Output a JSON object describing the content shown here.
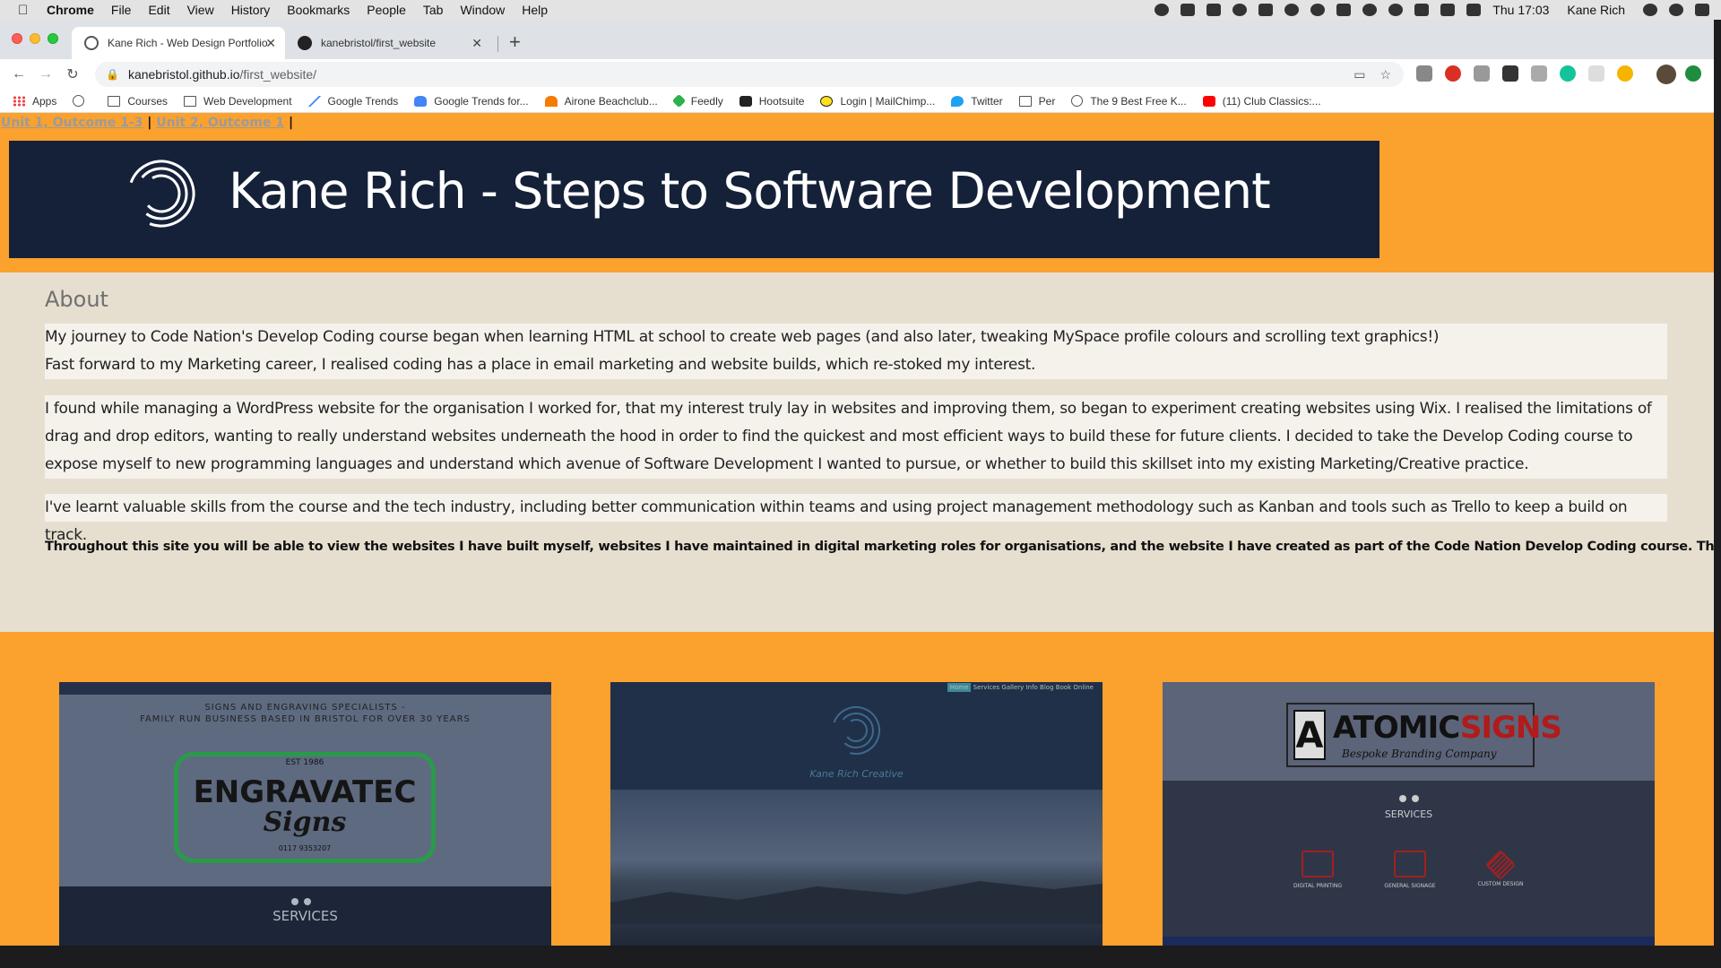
{
  "menubar": {
    "app_name": "Chrome",
    "items": [
      "File",
      "Edit",
      "View",
      "History",
      "Bookmarks",
      "People",
      "Tab",
      "Window",
      "Help"
    ],
    "clock": "Thu 17:03",
    "user": "Kane Rich"
  },
  "browser": {
    "tabs": [
      {
        "title": "Kane Rich - Web Design Portfolio",
        "active": true
      },
      {
        "title": "kanebristol/first_website",
        "active": false
      }
    ],
    "url_host": "kanebristol.github.io",
    "url_path": "/first_website/",
    "bookmarks": [
      {
        "label": "Apps",
        "icon": "apps-grid-icon"
      },
      {
        "label": "Courses",
        "icon": "folder-icon"
      },
      {
        "label": "Web Development",
        "icon": "folder-icon"
      },
      {
        "label": "Google Trends",
        "icon": "google-trends-icon"
      },
      {
        "label": "Google Trends for...",
        "icon": "google-trends-icon"
      },
      {
        "label": "Airone Beachclub...",
        "icon": "airone-icon"
      },
      {
        "label": "Feedly",
        "icon": "feedly-icon"
      },
      {
        "label": "Hootsuite",
        "icon": "hootsuite-icon"
      },
      {
        "label": "Login | MailChimp...",
        "icon": "mailchimp-icon"
      },
      {
        "label": "Twitter",
        "icon": "twitter-icon"
      },
      {
        "label": "Per",
        "icon": "folder-icon"
      },
      {
        "label": "The 9 Best Free K...",
        "icon": "globe-icon"
      },
      {
        "label": "(11) Club Classics:...",
        "icon": "youtube-icon"
      }
    ]
  },
  "page": {
    "unit_links": [
      "Unit 1, Outcome 1-3",
      "Unit 2, Outcome 1"
    ],
    "separator": "|",
    "title": "Kane Rich - Steps to Software Development",
    "about": {
      "heading": "About",
      "p1_line1": "My journey to Code Nation's Develop Coding course began when learning HTML at school to create web pages (and also later, tweaking MySpace profile colours and scrolling text graphics!)",
      "p1_line2": "Fast forward to my Marketing career, I realised coding has a place in email marketing and website builds, which re-stoked my interest.",
      "p2": "I found while managing a WordPress website for the organisation I worked for, that my interest truly lay in websites and improving them, so began to experiment creating websites using Wix. I realised the limitations of drag and drop editors, wanting to really understand websites underneath the hood in order to find the quickest and most efficient ways to build these for future clients. I decided to take the Develop Coding course to expose myself to new programming languages and understand which avenue of Software Development I wanted to pursue, or whether to build this skillset into my existing Marketing/Creative practice.",
      "p3": "I've learnt valuable skills from the course and the tech industry, including better communication within teams and using project management methodology such as Kanban and tools such as Trello to keep a build on track.",
      "note": "Throughout this site you will be able to view the websites I have built myself, websites I have maintained in digital marketing roles for organisations, and the website I have created as part of the Code Nation Develop Coding course. Thanks for reading!"
    },
    "cards": {
      "engravatec": {
        "tagline_1": "SIGNS AND ENGRAVING SPECIALISTS -",
        "tagline_2": "FAMILY RUN BUSINESS BASED IN BRISTOL FOR OVER 30 YEARS",
        "badge_top": "EST 1986",
        "badge_main": "ENGRAVATEC",
        "badge_sub": "Signs",
        "badge_phone": "0117 9353207",
        "services": "SERVICES"
      },
      "kanerich": {
        "nav": [
          "Home",
          "Services",
          "Gallery",
          "Info",
          "Blog",
          "Book Online"
        ],
        "brand": "Kane Rich Creative"
      },
      "atomic": {
        "atomic": "ATOMIC",
        "signs": "SIGNS",
        "tagline": "Bespoke Branding Company",
        "services": "SERVICES",
        "svc": [
          "DIGITAL PRINTING",
          "GENERAL SIGNAGE",
          "CUSTOM DESIGN"
        ]
      }
    }
  },
  "colors": {
    "page_bg": "#fba12e",
    "header_bg": "#152138",
    "about_bg": "#e6dfd0",
    "para_bg": "#f5f2ec"
  }
}
